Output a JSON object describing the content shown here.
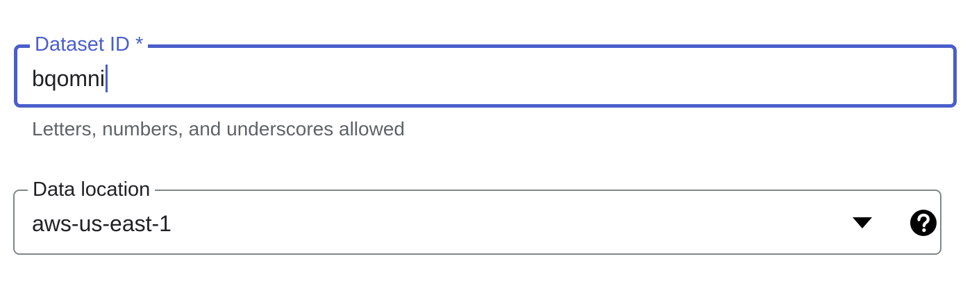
{
  "dataset_field": {
    "label": "Dataset ID *",
    "value": "bqomni",
    "hint": "Letters, numbers, and underscores allowed"
  },
  "location_field": {
    "label": "Data location",
    "selected": "aws-us-east-1"
  },
  "icons": {
    "dropdown": "arrow-drop-down-icon",
    "help": "help-icon"
  },
  "colors": {
    "focus": "#4a5ecb",
    "outline": "#80868b",
    "text": "#202124",
    "hint": "#5f6368"
  }
}
